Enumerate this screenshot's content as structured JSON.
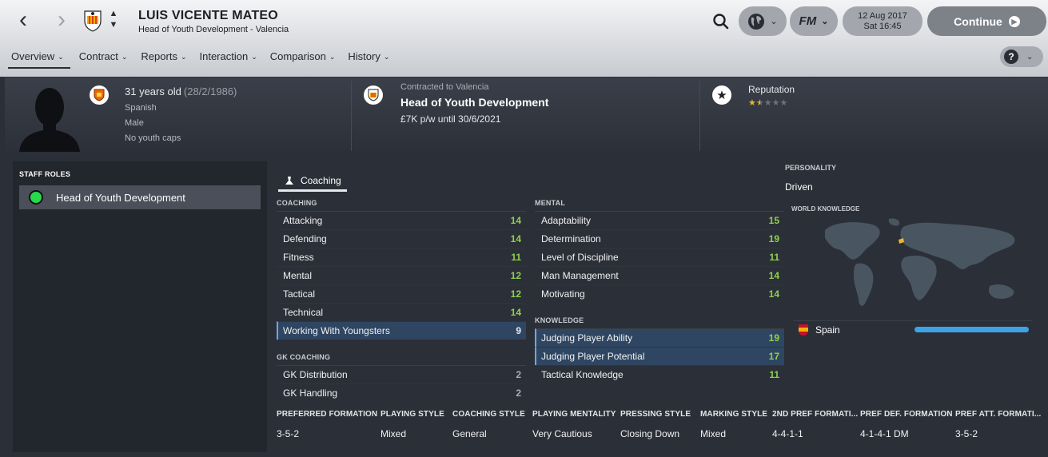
{
  "header": {
    "name": "LUIS VICENTE MATEO",
    "subtitle": "Head of Youth Development - Valencia",
    "date": "12 Aug 2017",
    "time": "Sat 16:45",
    "continue_label": "Continue",
    "fm_label": "FM"
  },
  "tabs": [
    {
      "label": "Overview",
      "active": true
    },
    {
      "label": "Contract"
    },
    {
      "label": "Reports"
    },
    {
      "label": "Interaction"
    },
    {
      "label": "Comparison"
    },
    {
      "label": "History"
    }
  ],
  "help": {
    "label": "?"
  },
  "info": {
    "age": "31 years old",
    "dob": "(28/2/1986)",
    "nationality": "Spanish",
    "gender": "Male",
    "caps": "No youth caps",
    "contracted_to": "Contracted to Valencia",
    "job_title": "Head of Youth Development",
    "wage": "£7K p/w until 30/6/2021",
    "reputation_label": "Reputation",
    "reputation_stars": 1.5,
    "reputation_max": 5
  },
  "staff_roles": {
    "title": "STAFF ROLES",
    "items": [
      {
        "label": "Head of Youth Development",
        "color": "#27d94d"
      }
    ]
  },
  "attributes_tab": {
    "label": "Coaching"
  },
  "coaching": {
    "title": "COACHING",
    "items": [
      {
        "name": "Attacking",
        "value": "14"
      },
      {
        "name": "Defending",
        "value": "14"
      },
      {
        "name": "Fitness",
        "value": "11"
      },
      {
        "name": "Mental",
        "value": "12"
      },
      {
        "name": "Tactical",
        "value": "12"
      },
      {
        "name": "Technical",
        "value": "14"
      },
      {
        "name": "Working With Youngsters",
        "value": "9",
        "highlight": true
      }
    ]
  },
  "gk_coaching": {
    "title": "GK COACHING",
    "items": [
      {
        "name": "GK Distribution",
        "value": "2"
      },
      {
        "name": "GK Handling",
        "value": "2"
      }
    ]
  },
  "mental": {
    "title": "MENTAL",
    "items": [
      {
        "name": "Adaptability",
        "value": "15"
      },
      {
        "name": "Determination",
        "value": "19"
      },
      {
        "name": "Level of Discipline",
        "value": "11"
      },
      {
        "name": "Man Management",
        "value": "14"
      },
      {
        "name": "Motivating",
        "value": "14"
      }
    ]
  },
  "knowledge": {
    "title": "KNOWLEDGE",
    "items": [
      {
        "name": "Judging Player Ability",
        "value": "19",
        "highlight": true
      },
      {
        "name": "Judging Player Potential",
        "value": "17",
        "highlight": true
      },
      {
        "name": "Tactical Knowledge",
        "value": "11"
      }
    ]
  },
  "personality": {
    "label": "PERSONALITY",
    "value": "Driven"
  },
  "world_knowledge": {
    "label": "WORLD KNOWLEDGE",
    "nation": "Spain",
    "level": 1.0,
    "bar_color": "#3ea3e6"
  },
  "tactics": [
    {
      "label": "PREFERRED FORMATION",
      "value": "3-5-2"
    },
    {
      "label": "PLAYING STYLE",
      "value": "Mixed"
    },
    {
      "label": "COACHING STYLE",
      "value": "General"
    },
    {
      "label": "PLAYING MENTALITY",
      "value": "Very Cautious"
    },
    {
      "label": "PRESSING STYLE",
      "value": "Closing Down"
    },
    {
      "label": "MARKING STYLE",
      "value": "Mixed"
    },
    {
      "label": "2ND PREF FORMATI...",
      "value": "4-4-1-1"
    },
    {
      "label": "PREF DEF. FORMATION",
      "value": "4-1-4-1 DM"
    },
    {
      "label": "PREF ATT. FORMATI...",
      "value": "3-5-2"
    }
  ],
  "colors": {
    "value_green": "#8fd14f",
    "value_grey": "#a8acb3",
    "star": "#e9b824"
  },
  "icons": [
    "back-arrow-icon",
    "forward-arrow-icon",
    "club-crest-icon",
    "search-icon",
    "globe-icon",
    "chevron-down-icon",
    "question-icon",
    "star-icon",
    "whistle-icon",
    "spain-flag-icon"
  ]
}
